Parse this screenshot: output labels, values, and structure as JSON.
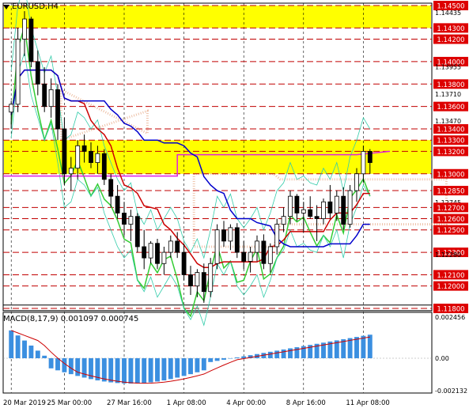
{
  "window": {
    "symbol_title": "EURUSD,H4"
  },
  "macd": {
    "label": "MACD(8,17,9) 0.001097 0.000745"
  },
  "colors": {
    "highlight": "#ffff00",
    "level_line": "#c00000",
    "up": "#00aa00",
    "down": "#cc0000",
    "macd_hist": "#3b8fe0",
    "macd_signal": "#cc0000",
    "ichimoku_cloud": "#e8b090"
  },
  "price_axis": {
    "levels": [
      {
        "label": "1.14500",
        "price": 1.145,
        "tag": true
      },
      {
        "label": "1.14435",
        "price": 1.14435,
        "tag": false
      },
      {
        "label": "1.14300",
        "price": 1.143,
        "tag": true
      },
      {
        "label": "1.14200",
        "price": 1.142,
        "tag": true
      },
      {
        "label": "1.14000",
        "price": 1.14,
        "tag": true
      },
      {
        "label": "1.13955",
        "price": 1.13955,
        "tag": false
      },
      {
        "label": "1.13800",
        "price": 1.138,
        "tag": true
      },
      {
        "label": "1.13710",
        "price": 1.1371,
        "tag": false
      },
      {
        "label": "1.13600",
        "price": 1.136,
        "tag": true
      },
      {
        "label": "1.13470",
        "price": 1.1347,
        "tag": false
      },
      {
        "label": "1.13400",
        "price": 1.134,
        "tag": true
      },
      {
        "label": "1.13300",
        "price": 1.133,
        "tag": true
      },
      {
        "label": "1.13200",
        "price": 1.132,
        "tag": true
      },
      {
        "label": "1.13000",
        "price": 1.13,
        "tag": true
      },
      {
        "label": "1.12850",
        "price": 1.1285,
        "tag": true
      },
      {
        "label": "1.12745",
        "price": 1.12745,
        "tag": false
      },
      {
        "label": "1.12700",
        "price": 1.127,
        "tag": true
      },
      {
        "label": "1.12600",
        "price": 1.126,
        "tag": true
      },
      {
        "label": "1.12500",
        "price": 1.125,
        "tag": true
      },
      {
        "label": "1.12300",
        "price": 1.123,
        "tag": true
      },
      {
        "label": "1.12280",
        "price": 1.1228,
        "tag": false
      },
      {
        "label": "1.12100",
        "price": 1.121,
        "tag": true
      },
      {
        "label": "1.12000",
        "price": 1.12,
        "tag": true
      },
      {
        "label": "1.11800",
        "price": 1.118,
        "tag": true
      }
    ],
    "zones": [
      {
        "from": 1.143,
        "to": 1.145
      },
      {
        "from": 1.13,
        "to": 1.133
      }
    ]
  },
  "macd_axis": {
    "labels": [
      "0.002456",
      "0.00",
      "-0.002132"
    ]
  },
  "time_axis": {
    "labels": [
      "20 Mar 2019",
      "25 Mar 00:00",
      "27 Mar 16:00",
      "1 Apr 08:00",
      "4 Apr 00:00",
      "8 Apr 16:00",
      "11 Apr 08:00"
    ]
  },
  "chart_data": {
    "type": "candlestick",
    "symbol": "EURUSD",
    "timeframe": "H4",
    "candles": [
      [
        1.1355,
        1.1365,
        1.134,
        1.1362
      ],
      [
        1.1362,
        1.143,
        1.1355,
        1.142
      ],
      [
        1.142,
        1.1445,
        1.1405,
        1.1438
      ],
      [
        1.1438,
        1.144,
        1.1395,
        1.14
      ],
      [
        1.14,
        1.141,
        1.137,
        1.138
      ],
      [
        1.138,
        1.1395,
        1.1355,
        1.136
      ],
      [
        1.136,
        1.1385,
        1.135,
        1.1375
      ],
      [
        1.1375,
        1.138,
        1.133,
        1.134
      ],
      [
        1.134,
        1.135,
        1.129,
        1.13
      ],
      [
        1.13,
        1.1315,
        1.1285,
        1.1305
      ],
      [
        1.1305,
        1.133,
        1.1295,
        1.1325
      ],
      [
        1.1325,
        1.1335,
        1.131,
        1.132
      ],
      [
        1.132,
        1.1328,
        1.1305,
        1.131
      ],
      [
        1.131,
        1.1325,
        1.13,
        1.1318
      ],
      [
        1.1318,
        1.1322,
        1.129,
        1.1295
      ],
      [
        1.1295,
        1.13,
        1.127,
        1.128
      ],
      [
        1.128,
        1.129,
        1.126,
        1.1265
      ],
      [
        1.1265,
        1.1275,
        1.1245,
        1.1255
      ],
      [
        1.1255,
        1.1268,
        1.124,
        1.1262
      ],
      [
        1.1262,
        1.1265,
        1.123,
        1.1235
      ],
      [
        1.1235,
        1.125,
        1.1215,
        1.1225
      ],
      [
        1.1225,
        1.124,
        1.122,
        1.1238
      ],
      [
        1.1238,
        1.1242,
        1.1215,
        1.122
      ],
      [
        1.122,
        1.1235,
        1.121,
        1.123
      ],
      [
        1.123,
        1.1245,
        1.1225,
        1.124
      ],
      [
        1.124,
        1.1248,
        1.1225,
        1.123
      ],
      [
        1.123,
        1.1238,
        1.1205,
        1.121
      ],
      [
        1.121,
        1.1218,
        1.1192,
        1.12
      ],
      [
        1.12,
        1.1215,
        1.119,
        1.1212
      ],
      [
        1.1212,
        1.122,
        1.1185,
        1.1195
      ],
      [
        1.1195,
        1.1225,
        1.119,
        1.122
      ],
      [
        1.122,
        1.1255,
        1.1215,
        1.125
      ],
      [
        1.125,
        1.1258,
        1.1235,
        1.124
      ],
      [
        1.124,
        1.1255,
        1.1232,
        1.1252
      ],
      [
        1.1252,
        1.1256,
        1.1225,
        1.123
      ],
      [
        1.123,
        1.124,
        1.1215,
        1.1222
      ],
      [
        1.1222,
        1.1235,
        1.1212,
        1.123
      ],
      [
        1.123,
        1.1245,
        1.1222,
        1.124
      ],
      [
        1.124,
        1.1246,
        1.1215,
        1.122
      ],
      [
        1.122,
        1.1238,
        1.1212,
        1.1235
      ],
      [
        1.1235,
        1.126,
        1.1228,
        1.1255
      ],
      [
        1.1255,
        1.127,
        1.1248,
        1.1262
      ],
      [
        1.1262,
        1.1285,
        1.1255,
        1.128
      ],
      [
        1.128,
        1.1282,
        1.1258,
        1.1265
      ],
      [
        1.1265,
        1.1275,
        1.1248,
        1.1268
      ],
      [
        1.1268,
        1.128,
        1.126,
        1.1262
      ],
      [
        1.1262,
        1.1272,
        1.124,
        1.126
      ],
      [
        1.126,
        1.1278,
        1.1255,
        1.1275
      ],
      [
        1.1275,
        1.129,
        1.126,
        1.1265
      ],
      [
        1.1265,
        1.1285,
        1.1258,
        1.128
      ],
      [
        1.128,
        1.1288,
        1.125,
        1.1255
      ],
      [
        1.1255,
        1.129,
        1.1252,
        1.1285
      ],
      [
        1.1285,
        1.1305,
        1.1275,
        1.13
      ],
      [
        1.13,
        1.1325,
        1.1292,
        1.132
      ],
      [
        1.132,
        1.1322,
        1.13,
        1.131
      ]
    ],
    "ylim": [
      1.118,
      1.145
    ],
    "indicators": [
      "Bollinger Bands",
      "Ichimoku",
      "MACD(8,17,9)"
    ]
  }
}
